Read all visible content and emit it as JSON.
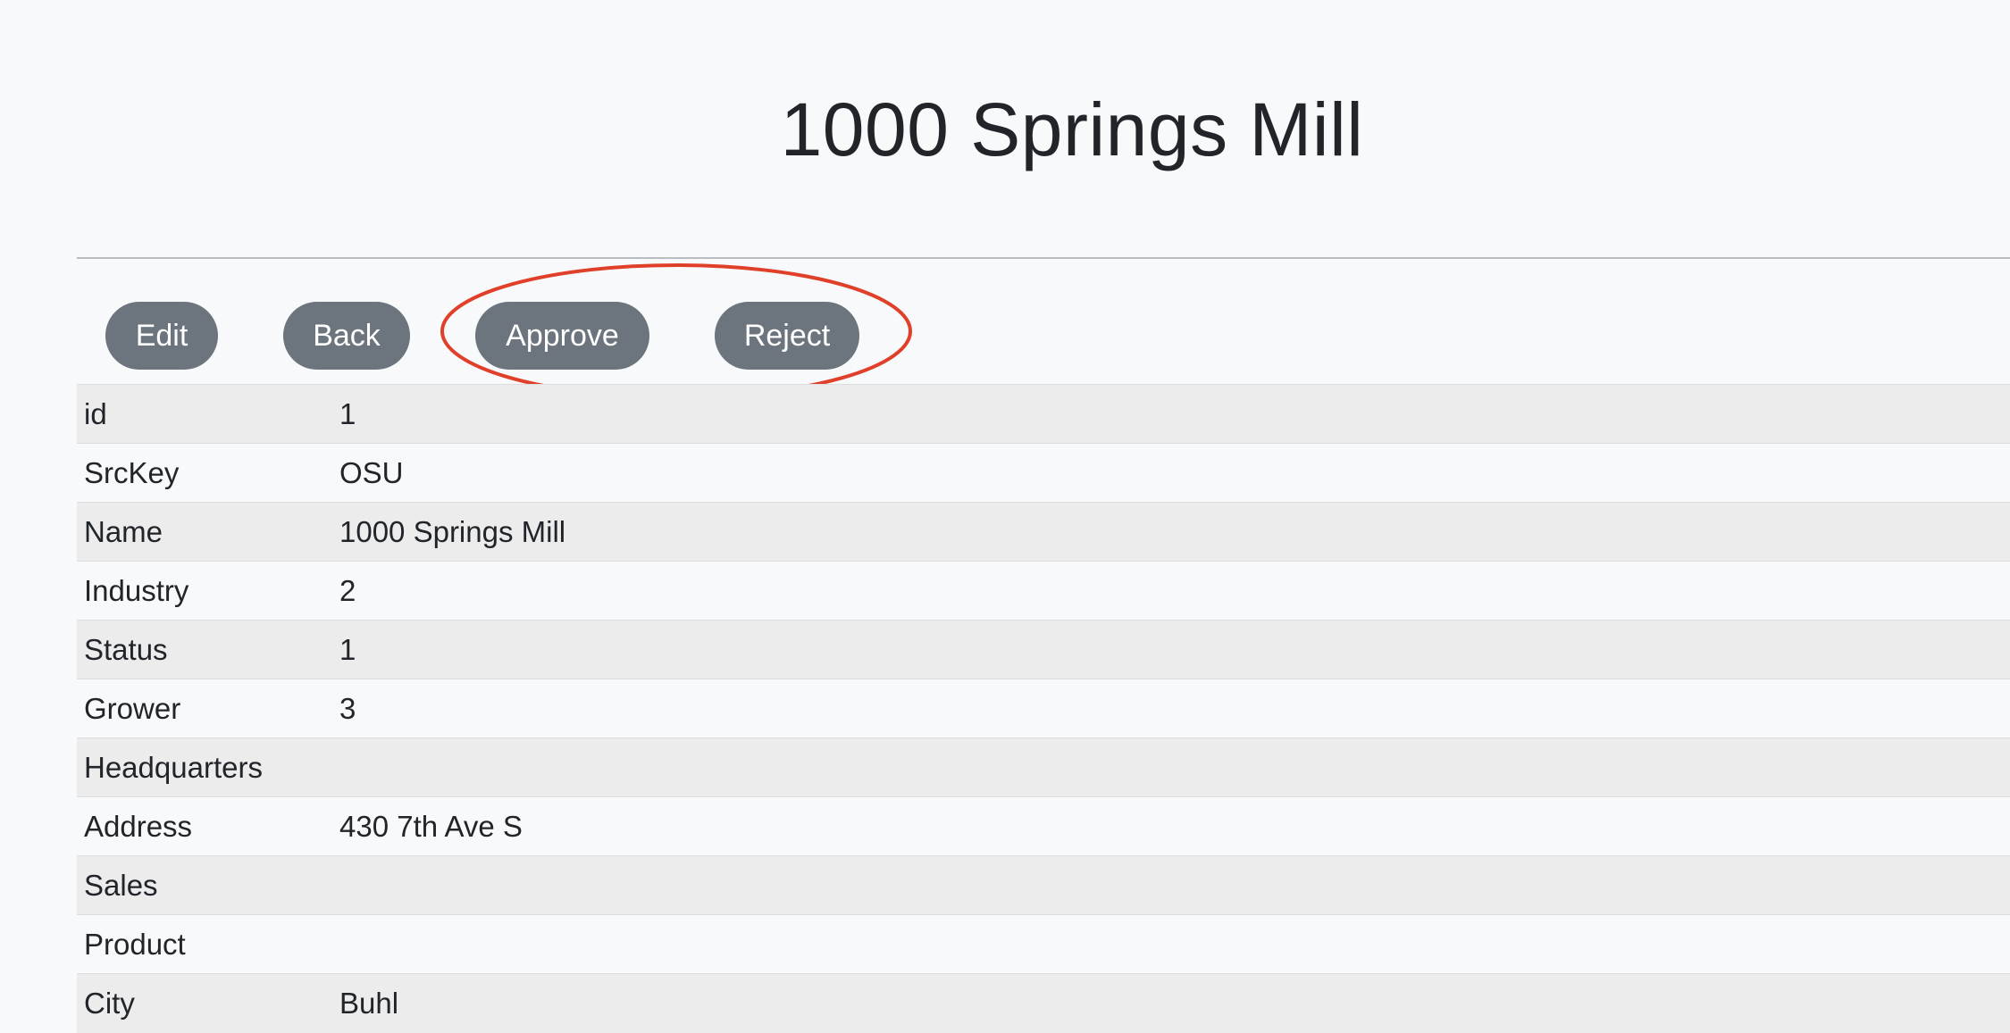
{
  "page": {
    "title": "1000 Springs Mill"
  },
  "actions": {
    "edit_label": "Edit",
    "back_label": "Back",
    "approve_label": "Approve",
    "reject_label": "Reject",
    "button_color": "#6c757d",
    "highlight_color": "#e0402a"
  },
  "details": {
    "rows": [
      {
        "key": "id",
        "value": "1"
      },
      {
        "key": "SrcKey",
        "value": "OSU"
      },
      {
        "key": "Name",
        "value": "1000 Springs Mill"
      },
      {
        "key": "Industry",
        "value": "2"
      },
      {
        "key": "Status",
        "value": "1"
      },
      {
        "key": "Grower",
        "value": "3"
      },
      {
        "key": "Headquarters",
        "value": ""
      },
      {
        "key": "Address",
        "value": "430 7th Ave S"
      },
      {
        "key": "Sales",
        "value": ""
      },
      {
        "key": "Product",
        "value": ""
      },
      {
        "key": "City",
        "value": "Buhl"
      }
    ]
  }
}
